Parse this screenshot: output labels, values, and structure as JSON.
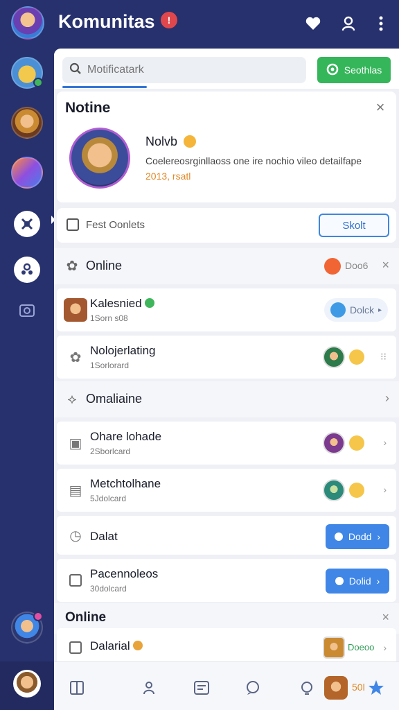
{
  "header": {
    "title": "Komunitas",
    "badge": "!"
  },
  "search": {
    "placeholder": "Motificatark",
    "button_label": "Seothlas"
  },
  "notice": {
    "title": "Notine",
    "name": "Nolvb",
    "description": "Coelereosrginllaoss one ire nochio vileo detailfape",
    "date": "2013, rsatl"
  },
  "post": {
    "label": "Fest Oonlets",
    "button_label": "Skolt"
  },
  "sections": [
    {
      "title": "Online",
      "right_label": "Doo6"
    },
    {
      "title": "Omaliaine"
    },
    {
      "title": "Online"
    }
  ],
  "items": [
    {
      "name": "Kalesnied",
      "sub": "1Sorn s08",
      "button_label": "Dolck"
    },
    {
      "name": "Nolojerlating",
      "sub": "1Sorlorard"
    },
    {
      "name": "Ohare lohade",
      "sub": "2Sborlcard"
    },
    {
      "name": "Metchtolhane",
      "sub": "5Jdolcard"
    },
    {
      "name": "Dalat",
      "button_label": "Dodd"
    },
    {
      "name": "Pacennoleos",
      "sub": "30dolcard",
      "button_label": "Dolid"
    },
    {
      "name": "Dalarial",
      "button_label": "Doeoo"
    }
  ],
  "bottom": {
    "label": "50l"
  },
  "colors": {
    "accent": "#3f86e6",
    "green": "#35b65a",
    "rail": "#27316d"
  }
}
